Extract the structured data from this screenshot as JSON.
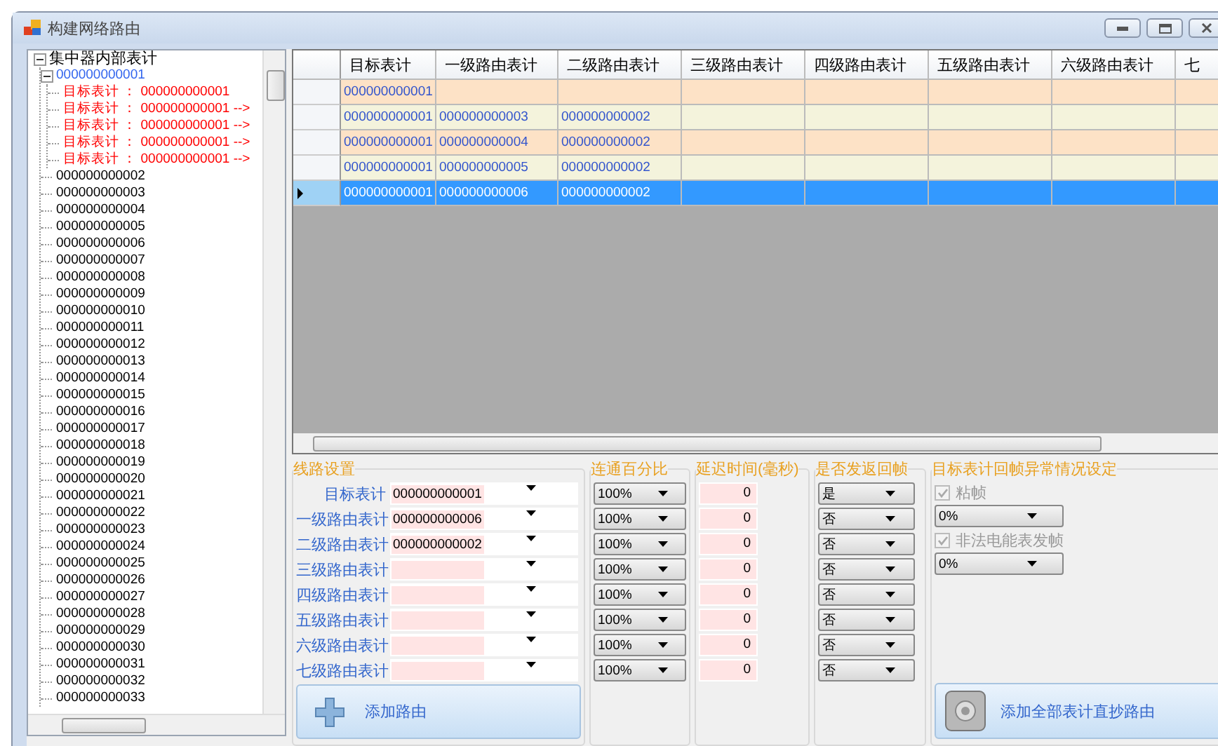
{
  "window": {
    "title": "构建网络路由"
  },
  "tree": {
    "label": "集中器内部表计",
    "kind": "group",
    "expanded": true,
    "selected": false,
    "children": [
      {
        "label": "000000000001",
        "kind": "meter",
        "expanded": true,
        "selected": true,
        "children": [
          {
            "label": "目标表计 ： 000000000001",
            "kind": "route",
            "selected": false
          },
          {
            "label": "目标表计 ： 000000000001 -->",
            "kind": "route",
            "selected": false
          },
          {
            "label": "目标表计 ： 000000000001 -->",
            "kind": "route",
            "selected": false
          },
          {
            "label": "目标表计 ： 000000000001 -->",
            "kind": "route",
            "selected": false
          },
          {
            "label": "目标表计 ： 000000000001 -->",
            "kind": "route",
            "selected": false
          }
        ]
      },
      {
        "label": "000000000002",
        "kind": "meter",
        "selected": false
      },
      {
        "label": "000000000003",
        "kind": "meter",
        "selected": false
      },
      {
        "label": "000000000004",
        "kind": "meter",
        "selected": false
      },
      {
        "label": "000000000005",
        "kind": "meter",
        "selected": false
      },
      {
        "label": "000000000006",
        "kind": "meter",
        "selected": false
      },
      {
        "label": "000000000007",
        "kind": "meter",
        "selected": false
      },
      {
        "label": "000000000008",
        "kind": "meter",
        "selected": false
      },
      {
        "label": "000000000009",
        "kind": "meter",
        "selected": false
      },
      {
        "label": "000000000010",
        "kind": "meter",
        "selected": false
      },
      {
        "label": "000000000011",
        "kind": "meter",
        "selected": false
      },
      {
        "label": "000000000012",
        "kind": "meter",
        "selected": false
      },
      {
        "label": "000000000013",
        "kind": "meter",
        "selected": false
      },
      {
        "label": "000000000014",
        "kind": "meter",
        "selected": false
      },
      {
        "label": "000000000015",
        "kind": "meter",
        "selected": false
      },
      {
        "label": "000000000016",
        "kind": "meter",
        "selected": false
      },
      {
        "label": "000000000017",
        "kind": "meter",
        "selected": false
      },
      {
        "label": "000000000018",
        "kind": "meter",
        "selected": false
      },
      {
        "label": "000000000019",
        "kind": "meter",
        "selected": false
      },
      {
        "label": "000000000020",
        "kind": "meter",
        "selected": false
      },
      {
        "label": "000000000021",
        "kind": "meter",
        "selected": false
      },
      {
        "label": "000000000022",
        "kind": "meter",
        "selected": false
      },
      {
        "label": "000000000023",
        "kind": "meter",
        "selected": false
      },
      {
        "label": "000000000024",
        "kind": "meter",
        "selected": false
      },
      {
        "label": "000000000025",
        "kind": "meter",
        "selected": false
      },
      {
        "label": "000000000026",
        "kind": "meter",
        "selected": false
      },
      {
        "label": "000000000027",
        "kind": "meter",
        "selected": false
      },
      {
        "label": "000000000028",
        "kind": "meter",
        "selected": false
      },
      {
        "label": "000000000029",
        "kind": "meter",
        "selected": false
      },
      {
        "label": "000000000030",
        "kind": "meter",
        "selected": false
      },
      {
        "label": "000000000031",
        "kind": "meter",
        "selected": false
      },
      {
        "label": "000000000032",
        "kind": "meter",
        "selected": false
      },
      {
        "label": "000000000033",
        "kind": "meter",
        "selected": false
      }
    ]
  },
  "grid": {
    "columns": [
      "目标表计",
      "一级路由表计",
      "二级路由表计",
      "三级路由表计",
      "四级路由表计",
      "五级路由表计",
      "六级路由表计",
      "七"
    ],
    "rows": [
      {
        "cells": [
          "000000000001"
        ],
        "selected": false
      },
      {
        "cells": [
          "000000000001",
          "000000000003",
          "000000000002"
        ],
        "selected": false
      },
      {
        "cells": [
          "000000000001",
          "000000000004",
          "000000000002"
        ],
        "selected": false
      },
      {
        "cells": [
          "000000000001",
          "000000000005",
          "000000000002"
        ],
        "selected": false
      },
      {
        "cells": [
          "000000000001",
          "000000000006",
          "000000000002"
        ],
        "selected": true
      }
    ]
  },
  "route_settings": {
    "title": "线路设置",
    "rows": [
      {
        "label": "目标表计",
        "meter": "000000000001"
      },
      {
        "label": "一级路由表计",
        "meter": "000000000006"
      },
      {
        "label": "二级路由表计",
        "meter": "000000000002"
      },
      {
        "label": "三级路由表计"
      },
      {
        "label": "四级路由表计"
      },
      {
        "label": "五级路由表计"
      },
      {
        "label": "六级路由表计"
      },
      {
        "label": "七级路由表计"
      }
    ],
    "add_button": "添加路由"
  },
  "connectivity": {
    "title": "连通百分比",
    "values": [
      "100%",
      "100%",
      "100%",
      "100%",
      "100%",
      "100%",
      "100%",
      "100%"
    ]
  },
  "delay": {
    "title": "延迟时间(毫秒)",
    "values": [
      "0",
      "0",
      "0",
      "0",
      "0",
      "0",
      "0",
      "0"
    ]
  },
  "reply": {
    "title": "是否发返回帧",
    "values": [
      "是",
      "否",
      "否",
      "否",
      "否",
      "否",
      "否",
      "否"
    ]
  },
  "exception": {
    "title": "目标表计回帧异常情况设定",
    "options": [
      {
        "label": "粘帧",
        "checked": true,
        "disabled": true,
        "value": "0%"
      },
      {
        "label": "非法电能表发帧",
        "checked": true,
        "disabled": true,
        "value": "0%"
      }
    ],
    "button": "添加全部表计直抄路由"
  }
}
